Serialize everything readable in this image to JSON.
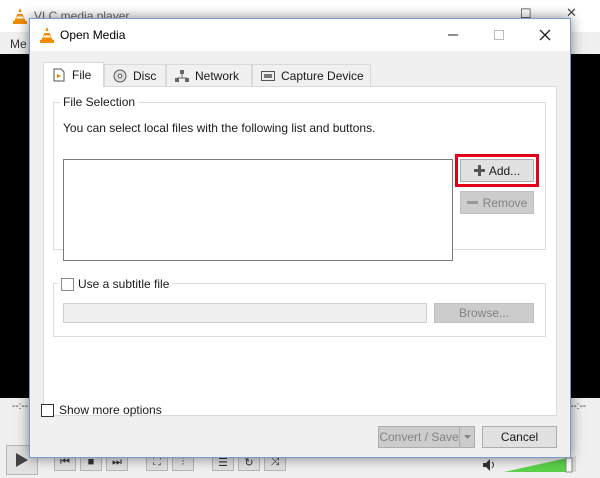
{
  "background_app": {
    "title": "VLC media player",
    "menu_partial": "Me",
    "time_elapsed": "--:--",
    "time_total": "--:--"
  },
  "dialog": {
    "title": "Open Media",
    "tabs": [
      {
        "label": "File",
        "icon": "file-icon"
      },
      {
        "label": "Disc",
        "icon": "disc-icon"
      },
      {
        "label": "Network",
        "icon": "network-icon"
      },
      {
        "label": "Capture Device",
        "icon": "capture-device-icon"
      }
    ],
    "file_selection": {
      "group_label": "File Selection",
      "description": "You can select local files with the following list and buttons.",
      "add_label": "Add...",
      "remove_label": "Remove"
    },
    "subtitle": {
      "checkbox_label": "Use a subtitle file",
      "browse_label": "Browse..."
    },
    "show_more_label": "Show more options",
    "convert_label": "Convert / Save",
    "cancel_label": "Cancel"
  },
  "colors": {
    "highlight": "#e2001a",
    "accent_border": "#7a9bd0",
    "volume_fill": "#5bd24a"
  }
}
